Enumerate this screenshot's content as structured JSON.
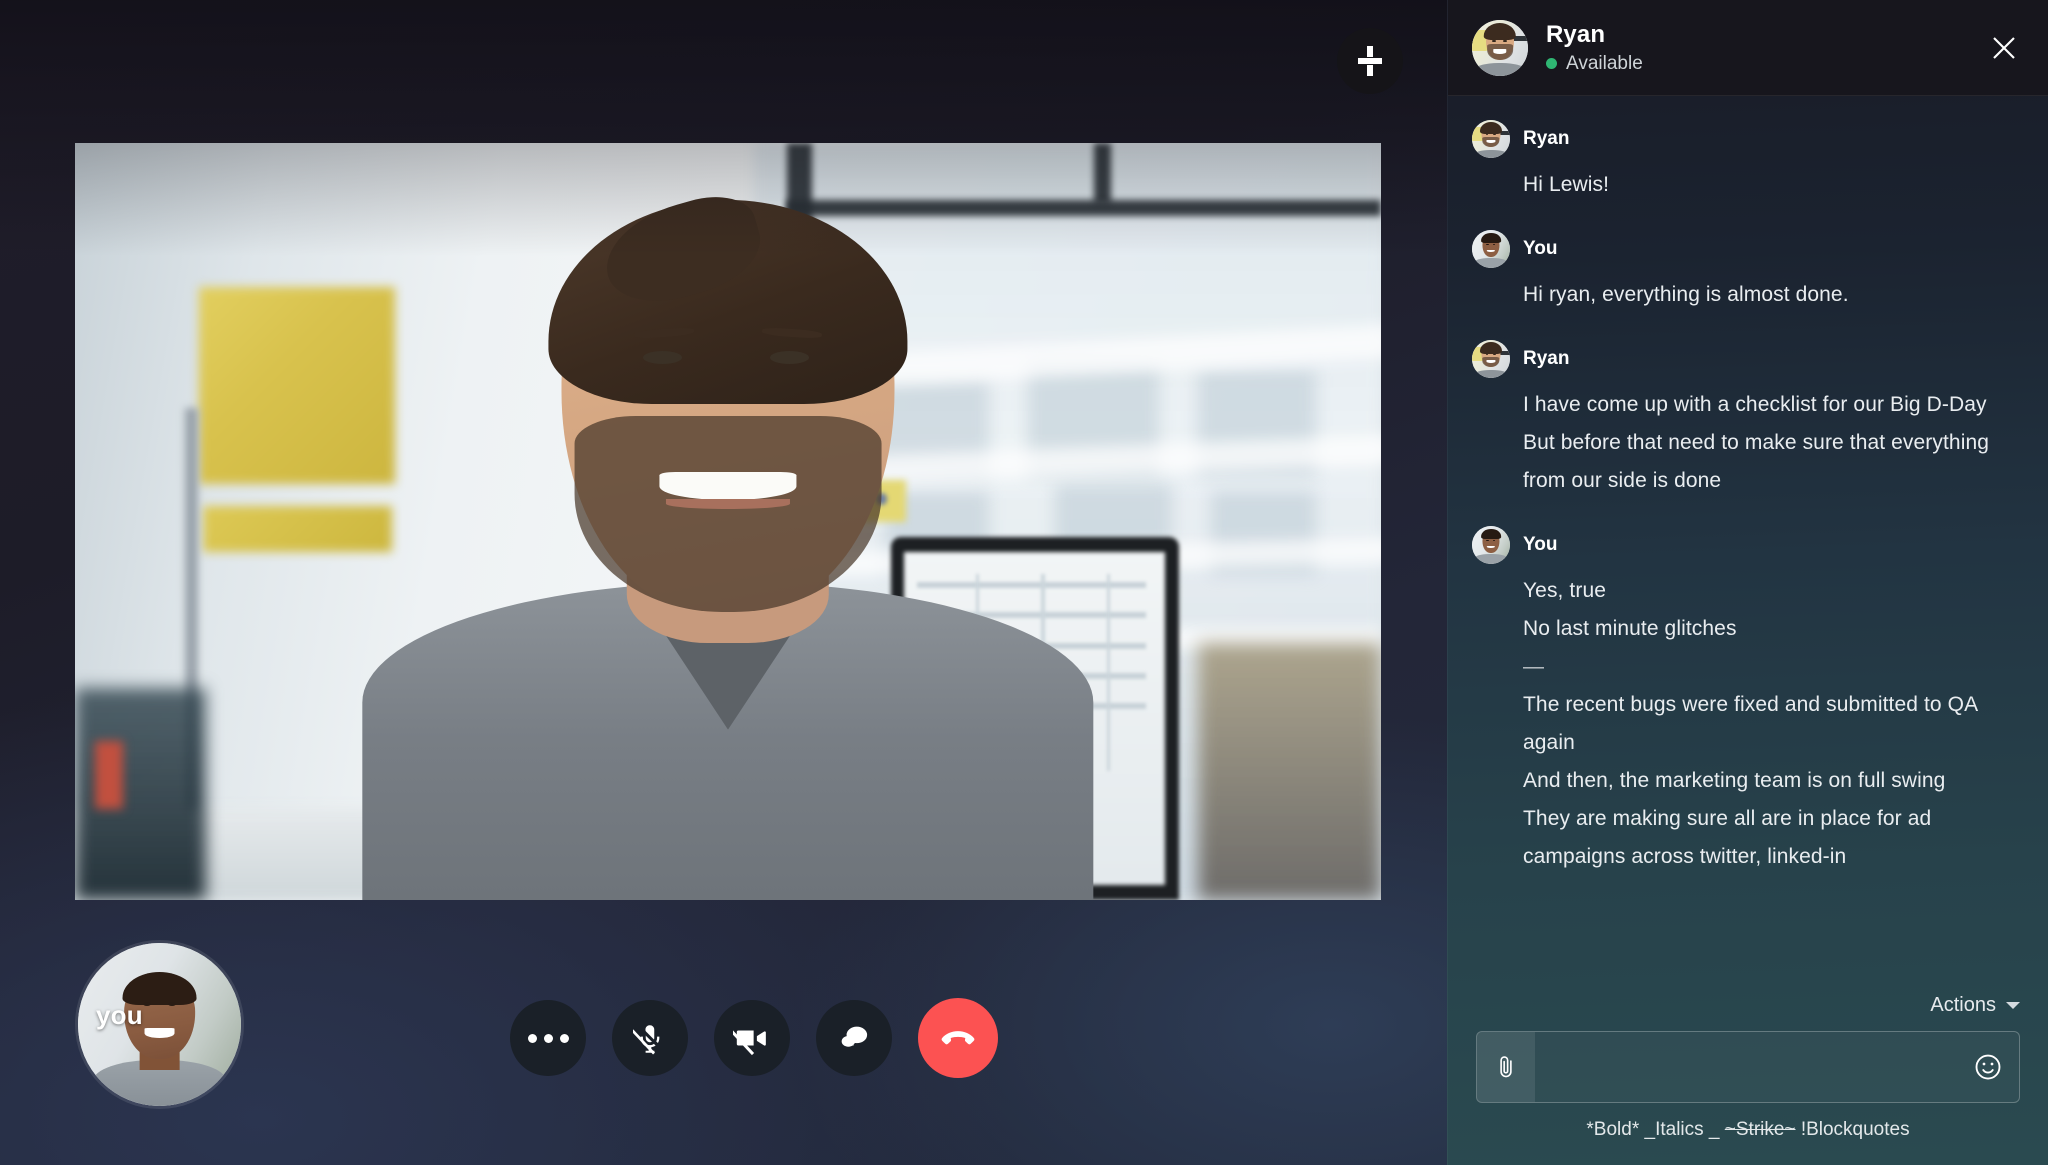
{
  "stage": {
    "collapse_icon": "collapse-fullscreen-icon",
    "self_view": {
      "label": "you",
      "avatar_icon": "self-view-avatar"
    },
    "remote_video": {
      "participant": "Ryan",
      "scene": "man smiling in bright office with monitor, yellow cabinet and window"
    },
    "controls": [
      {
        "name": "more-options-button",
        "icon": "ellipsis-icon",
        "label": "More options",
        "state": "default"
      },
      {
        "name": "mic-button",
        "icon": "microphone-muted-icon",
        "label": "Microphone",
        "state": "muted"
      },
      {
        "name": "camera-button",
        "icon": "video-camera-off-icon",
        "label": "Camera",
        "state": "off"
      },
      {
        "name": "chat-button",
        "icon": "chat-bubble-icon",
        "label": "Chat",
        "state": "default"
      },
      {
        "name": "end-call-button",
        "icon": "phone-hangup-icon",
        "label": "End call",
        "state": "danger"
      }
    ],
    "end_call_color": "#fc5252"
  },
  "chat": {
    "header": {
      "name": "Ryan",
      "status": "Available",
      "status_color": "#2fb673",
      "close_icon": "close-icon"
    },
    "messages": [
      {
        "author": "Ryan",
        "avatar": "ryan-avatar",
        "lines": [
          "Hi Lewis!"
        ]
      },
      {
        "author": "You",
        "avatar": "you-avatar",
        "lines": [
          "Hi ryan, everything is almost done."
        ]
      },
      {
        "author": "Ryan",
        "avatar": "ryan-avatar",
        "lines": [
          "I have come up with a checklist for our Big D-Day",
          "But before that need to make sure that everything",
          "from our side is done"
        ]
      },
      {
        "author": "You",
        "avatar": "you-avatar",
        "lines": [
          "Yes, true",
          "No last minute glitches",
          "—",
          "The recent bugs were fixed and submitted to QA",
          "again",
          "And then, the marketing team is on full swing",
          "They are making sure all are in place for ad",
          "campaigns across twitter, linked-in"
        ]
      }
    ],
    "composer": {
      "actions_label": "Actions",
      "attach_icon": "paperclip-icon",
      "emoji_icon": "smiley-icon",
      "input_value": "",
      "input_placeholder": "",
      "format_hint": {
        "bold": "*Bold*",
        "italics": "_Italics _",
        "strike": "~Strike~",
        "blockquotes": "!Blockquotes"
      }
    }
  }
}
